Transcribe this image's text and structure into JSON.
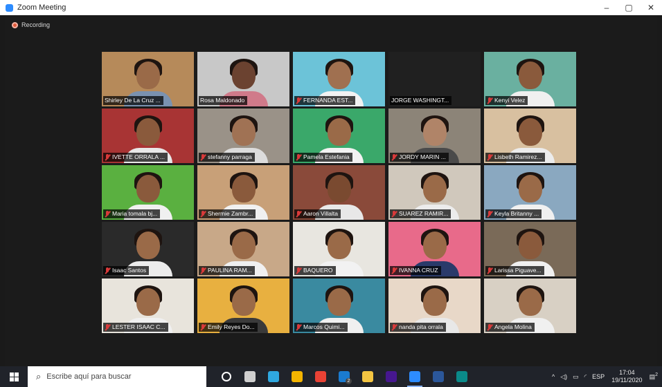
{
  "window": {
    "title": "Zoom Meeting",
    "controls": [
      "–",
      "▢",
      "✕"
    ]
  },
  "recording": {
    "label": "Recording"
  },
  "participants": [
    {
      "name": "Shirley De La Cruz ...",
      "muted": false,
      "active": true,
      "bg": "#b68a5a",
      "skin": "#9a6a48",
      "shirt": "#7a92b0"
    },
    {
      "name": "Rosa Maldonado",
      "muted": false,
      "active": false,
      "bg": "#c8c8c8",
      "skin": "#6b4230",
      "shirt": "#d07a8a"
    },
    {
      "name": "FERNANDA EST...",
      "muted": true,
      "active": false,
      "bg": "#6cc3d8",
      "skin": "#a07050",
      "shirt": "#f2f2f2"
    },
    {
      "name": "JORGE WASHINGT...",
      "muted": false,
      "active": false,
      "bg": "#202020",
      "skin": null,
      "shirt": null
    },
    {
      "name": "Kenyi Velez",
      "muted": true,
      "active": false,
      "bg": "#6ab0a0",
      "skin": "#8a5a3c",
      "shirt": "#f0f0f0"
    },
    {
      "name": "IVETTE ORRALA ...",
      "muted": true,
      "active": false,
      "bg": "#a83434",
      "skin": "#8a5a3c",
      "shirt": "#e8e8e8"
    },
    {
      "name": "stefanny parraga",
      "muted": true,
      "active": false,
      "bg": "#9a9288",
      "skin": "#a07254",
      "shirt": "#dcdcdc"
    },
    {
      "name": "Pamela Estefania",
      "muted": true,
      "active": false,
      "bg": "#3aa86a",
      "skin": "#9a6a48",
      "shirt": "#f2f2f2"
    },
    {
      "name": "JORDY MARIN ...",
      "muted": true,
      "active": false,
      "bg": "#8c8478",
      "skin": "#b08468",
      "shirt": "#4a4a4a"
    },
    {
      "name": "Lisbeth Ramirez...",
      "muted": true,
      "active": false,
      "bg": "#d8c0a0",
      "skin": "#8a5a3c",
      "shirt": "#ececec"
    },
    {
      "name": "Maria tomala bj...",
      "muted": true,
      "active": false,
      "bg": "#5ab040",
      "skin": "#8a5a3c",
      "shirt": "#f0f0f0"
    },
    {
      "name": "Shermie Zambr...",
      "muted": true,
      "active": false,
      "bg": "#c8a078",
      "skin": "#8a5a3c",
      "shirt": "#f0f0f0"
    },
    {
      "name": "Aaron Villalta",
      "muted": true,
      "active": false,
      "bg": "#8a4a3a",
      "skin": "#7a4a30",
      "shirt": "#e8e8e8"
    },
    {
      "name": "SUAREZ RAMIR...",
      "muted": true,
      "active": false,
      "bg": "#d0c8bc",
      "skin": "#9a6a48",
      "shirt": "#ececec"
    },
    {
      "name": "Keyla Britanny ...",
      "muted": true,
      "active": false,
      "bg": "#8aa8c0",
      "skin": "#9a6a48",
      "shirt": "#f0f0f0"
    },
    {
      "name": "Isaac Santos",
      "muted": true,
      "active": false,
      "bg": "#2a2a2a",
      "skin": "#9a6a48",
      "shirt": "#ececec"
    },
    {
      "name": "PAULINA RAM...",
      "muted": true,
      "active": false,
      "bg": "#c8a888",
      "skin": "#9a6a48",
      "shirt": "#f0f0f0"
    },
    {
      "name": "BAQUERO",
      "muted": true,
      "active": false,
      "bg": "#e8e6e0",
      "skin": "#9a6a48",
      "shirt": "#f2f2f2"
    },
    {
      "name": "IVANNA CRUZ",
      "muted": true,
      "active": false,
      "bg": "#e86a8a",
      "skin": "#9a6a48",
      "shirt": "#2a3a6a"
    },
    {
      "name": "Larissa Piguave...",
      "muted": true,
      "active": false,
      "bg": "#7a6a58",
      "skin": "#8a5a3c",
      "shirt": "#f0f0f0"
    },
    {
      "name": "LESTER ISAAC C...",
      "muted": true,
      "active": false,
      "bg": "#e8e4dc",
      "skin": "#9a6a48",
      "shirt": "#f0f0f0"
    },
    {
      "name": "Emily Reyes Do...",
      "muted": true,
      "active": false,
      "bg": "#e8b040",
      "skin": "#9a6a48",
      "shirt": "#3a3a3a"
    },
    {
      "name": "Marcos Quimi...",
      "muted": true,
      "active": false,
      "bg": "#3a8aa0",
      "skin": "#9a6a48",
      "shirt": "#f0f0f0"
    },
    {
      "name": "nanda pita orrala",
      "muted": true,
      "active": false,
      "bg": "#e8d8c8",
      "skin": "#9a6a48",
      "shirt": "#e8e8e8"
    },
    {
      "name": "Angela Molina",
      "muted": true,
      "active": false,
      "bg": "#d8d0c4",
      "skin": "#9a6a48",
      "shirt": "#f0f0f0"
    }
  ],
  "taskbar": {
    "search_placeholder": "Escribe aquí para buscar",
    "apps": [
      {
        "name": "cortana-icon",
        "color": "#ffffff",
        "active": false
      },
      {
        "name": "task-view-icon",
        "color": "#cfcfcf",
        "active": false
      },
      {
        "name": "edge-icon",
        "color": "#2fa8e0",
        "active": false
      },
      {
        "name": "store-icon",
        "color": "#f4b400",
        "active": false
      },
      {
        "name": "chrome-icon",
        "color": "#e94235",
        "active": false
      },
      {
        "name": "mail-icon",
        "color": "#1a7bd0",
        "active": false
      },
      {
        "name": "folder-icon",
        "color": "#f4c542",
        "active": false
      },
      {
        "name": "kahoot-icon",
        "color": "#46178f",
        "active": false
      },
      {
        "name": "zoom-icon",
        "color": "#2d8cff",
        "active": true
      },
      {
        "name": "word-icon",
        "color": "#2b579a",
        "active": false
      },
      {
        "name": "edge-new-icon",
        "color": "#0a8a8a",
        "active": false
      }
    ],
    "mail_badge": "2",
    "tray": {
      "lang": "ESP",
      "time": "17:04",
      "date": "19/11/2020",
      "notifications": "2"
    }
  }
}
